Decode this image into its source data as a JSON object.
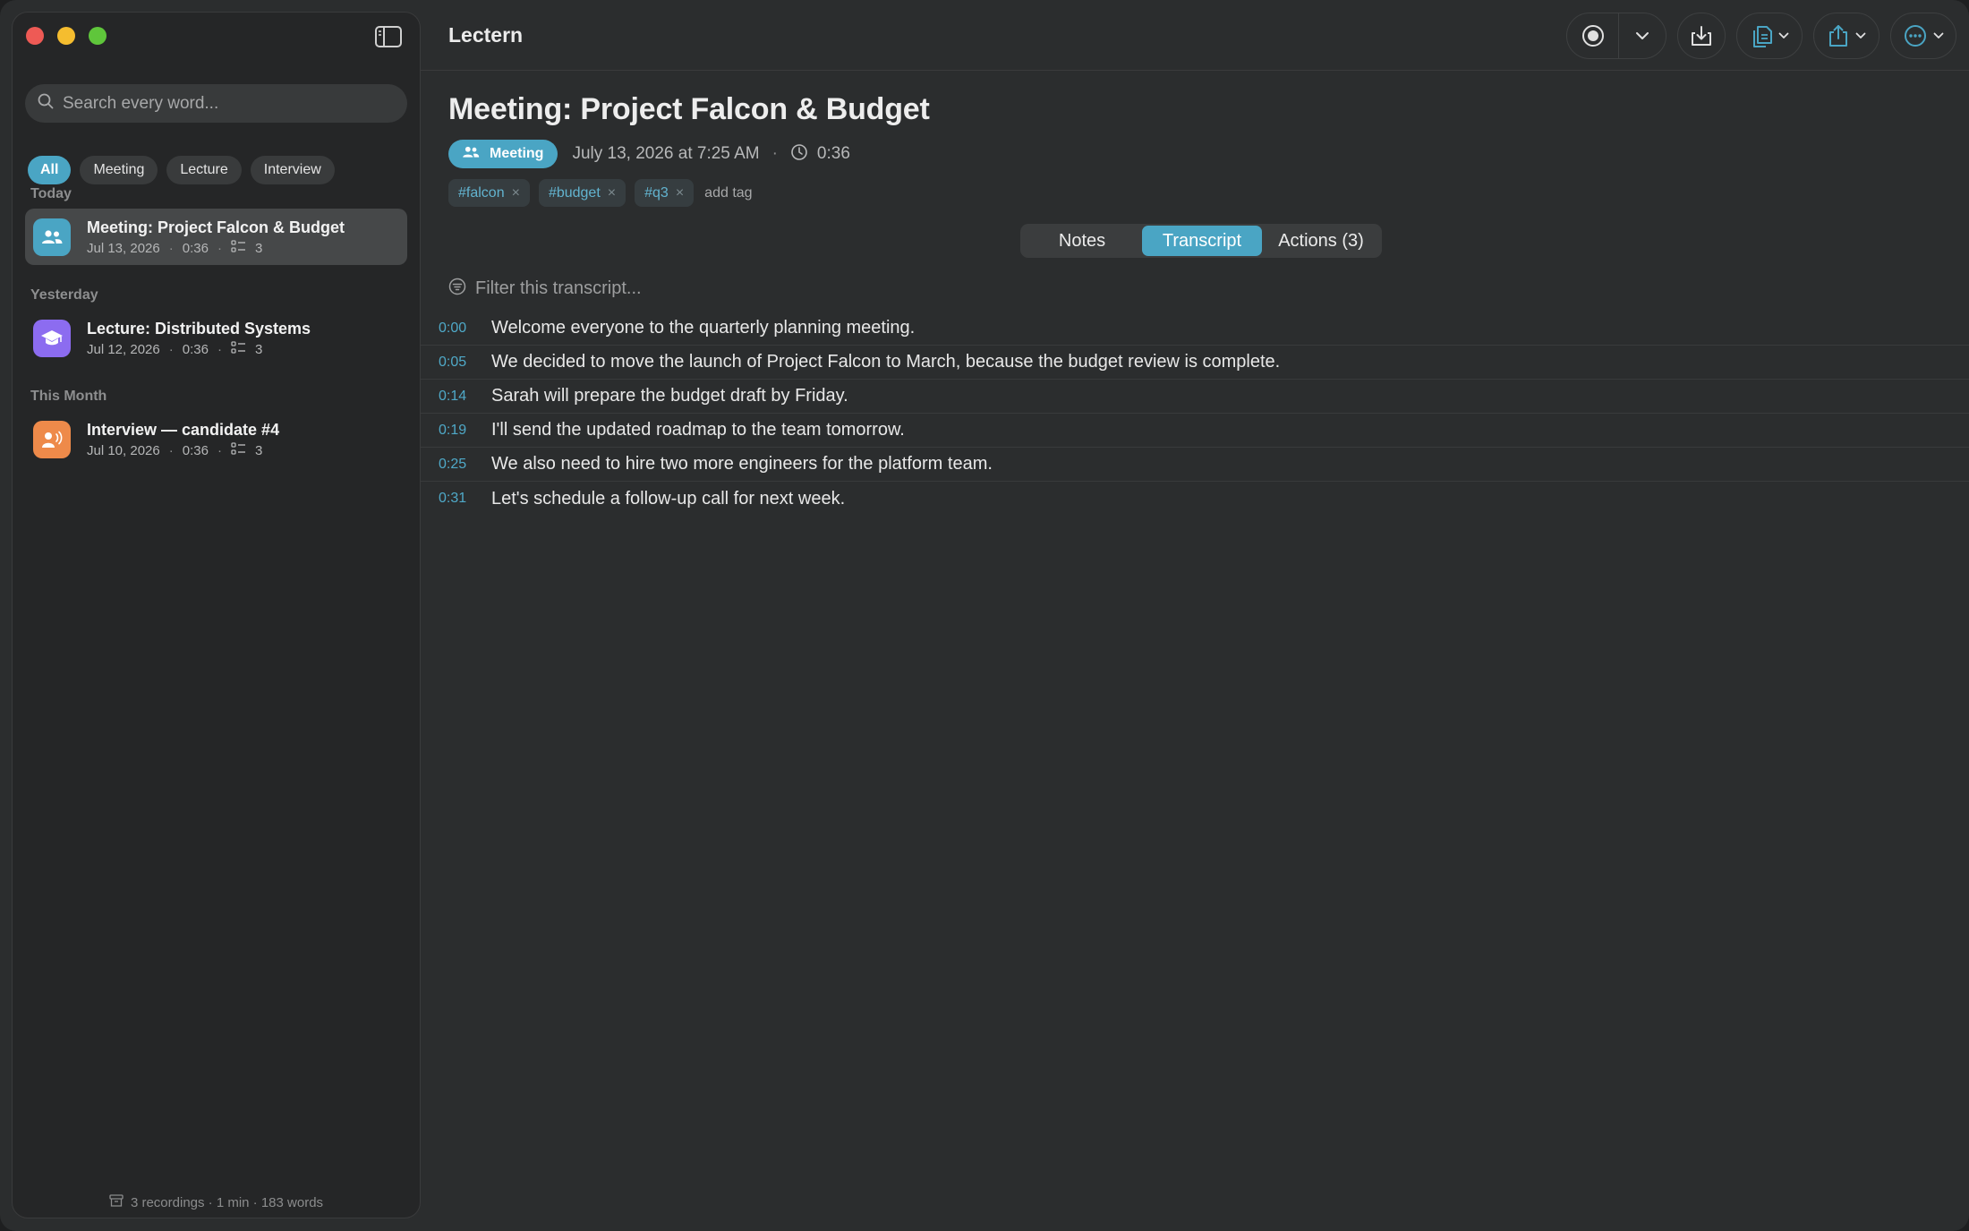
{
  "app": {
    "title": "Lectern"
  },
  "sidebar": {
    "search_placeholder": "Search every word...",
    "filters": [
      "All",
      "Meeting",
      "Lecture",
      "Interview"
    ],
    "sections": [
      "Today",
      "Yesterday",
      "This Month"
    ],
    "recordings": [
      {
        "title": "Meeting: Project Falcon & Budget",
        "date": "Jul 13, 2026",
        "duration": "0:36",
        "actions": "3",
        "type": "meeting",
        "color": "#4aa5c4"
      },
      {
        "title": "Lecture: Distributed Systems",
        "date": "Jul 12, 2026",
        "duration": "0:36",
        "actions": "3",
        "type": "lecture",
        "color": "#8c6cf0"
      },
      {
        "title": "Interview — candidate #4",
        "date": "Jul 10, 2026",
        "duration": "0:36",
        "actions": "3",
        "type": "interview",
        "color": "#ee8a4a"
      }
    ],
    "footer": "3 recordings · 1 min · 183 words"
  },
  "document": {
    "title": "Meeting: Project Falcon & Budget",
    "type_badge": "Meeting",
    "date": "July 13, 2026 at 7:25 AM",
    "separator": "·",
    "duration": "0:36",
    "tags": [
      "#falcon",
      "#budget",
      "#q3"
    ],
    "tag_remove": "×",
    "add_tag": "add tag",
    "tabs": [
      "Notes",
      "Transcript",
      "Actions (3)"
    ],
    "active_tab": "Transcript",
    "filter_placeholder": "Filter this transcript...",
    "transcript": [
      {
        "time": "0:00",
        "text": "Welcome everyone to the quarterly planning meeting."
      },
      {
        "time": "0:05",
        "text": "We decided to move the launch of Project Falcon to March, because the budget review is complete."
      },
      {
        "time": "0:14",
        "text": "Sarah will prepare the budget draft by Friday."
      },
      {
        "time": "0:19",
        "text": "I'll send the updated roadmap to the team tomorrow."
      },
      {
        "time": "0:25",
        "text": "We also need to hire two more engineers for the platform team."
      },
      {
        "time": "0:31",
        "text": "Let's schedule a follow-up call for next week."
      }
    ]
  },
  "colors": {
    "accent": "#4aa5c4",
    "window": "#2b2d2e",
    "sidebar": "#252627"
  },
  "icons": {
    "toolbar": [
      "record-icon",
      "chevron-down-icon",
      "import-icon",
      "copy-icon",
      "share-icon",
      "more-icon"
    ]
  }
}
